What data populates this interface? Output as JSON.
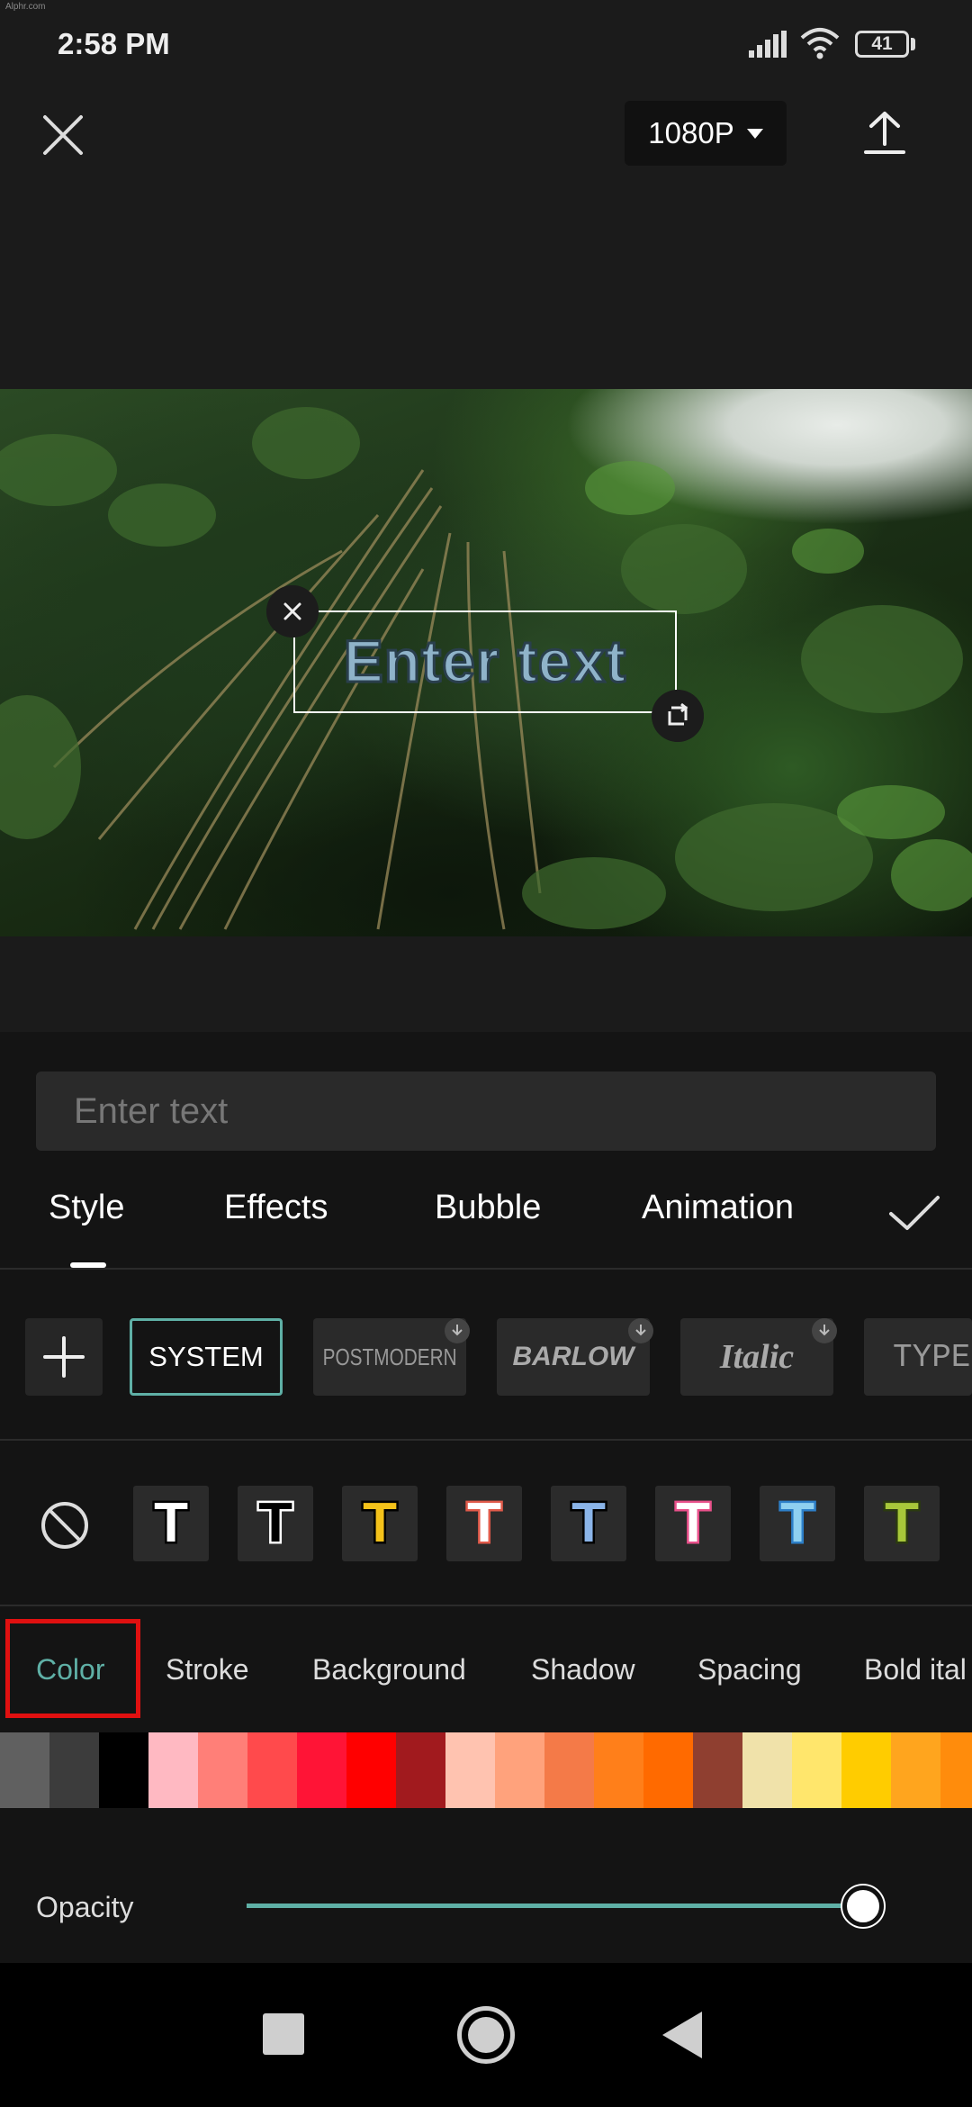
{
  "watermark": "Alphr.com",
  "status": {
    "time": "2:58 PM",
    "battery": "41"
  },
  "header": {
    "resolution": "1080P"
  },
  "preview": {
    "overlay_text": "Enter text"
  },
  "editor": {
    "placeholder": "Enter text",
    "tabs": [
      "Style",
      "Effects",
      "Bubble",
      "Animation"
    ],
    "fonts": [
      "SYSTEM",
      "POSTMODERN",
      "BARLOW",
      "Italic",
      "TYPEF"
    ],
    "presets": [
      {
        "fill": "#ffffff",
        "stroke": "#000000"
      },
      {
        "fill": "#000000",
        "stroke": "#ffffff"
      },
      {
        "fill": "#f4c21a",
        "stroke": "#000000"
      },
      {
        "fill": "#ffffff",
        "stroke": "#e05a4a"
      },
      {
        "fill": "#8ab4e8",
        "stroke": "#000000"
      },
      {
        "fill": "#ffffff",
        "stroke": "#e8508a"
      },
      {
        "fill": "#8fd0f0",
        "stroke": "#2d7fc8"
      },
      {
        "fill": "#a8c83a",
        "stroke": "#2b3a10"
      }
    ],
    "subtabs": [
      "Color",
      "Stroke",
      "Background",
      "Shadow",
      "Spacing",
      "Bold ital"
    ],
    "active_subtab": "Color",
    "swatches": [
      "#606060",
      "#3c3c3c",
      "#000000",
      "#ffb9c2",
      "#ff7f78",
      "#ff4a4c",
      "#ff1436",
      "#ff0000",
      "#a11a1e",
      "#ffc3b0",
      "#ffa27c",
      "#f47a48",
      "#ff7f1a",
      "#ff6a00",
      "#8f3f30",
      "#f0e2aa",
      "#ffe66c",
      "#ffcc00",
      "#ffa51e",
      "#ff8c0c"
    ],
    "opacity_label": "Opacity",
    "opacity_value": 1.0,
    "accent_color": "#5fb0a6"
  }
}
